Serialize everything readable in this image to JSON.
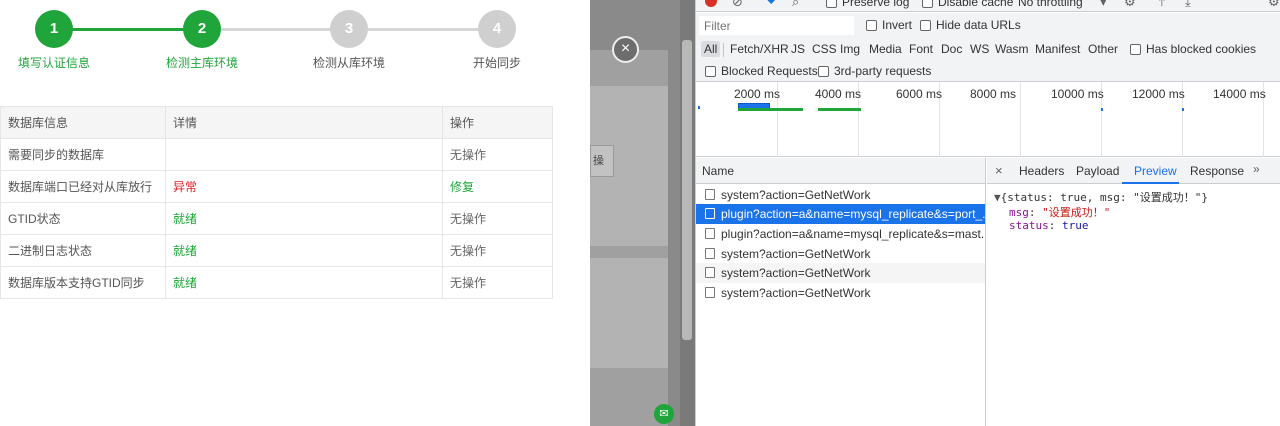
{
  "steps": [
    {
      "number": "1",
      "label": "填写认证信息",
      "state": "done"
    },
    {
      "number": "2",
      "label": "检测主库环境",
      "state": "done"
    },
    {
      "number": "3",
      "label": "检测从库环境",
      "state": "todo"
    },
    {
      "number": "4",
      "label": "开始同步",
      "state": "todo"
    }
  ],
  "table": {
    "headers": [
      "数据库信息",
      "详情",
      "操作"
    ],
    "rows": [
      {
        "info": "需要同步的数据库",
        "detail": "",
        "action": "无操作",
        "detail_status": "none",
        "action_type": "none"
      },
      {
        "info": "数据库端口已经对从库放行",
        "detail": "异常",
        "action": "修复",
        "detail_status": "error",
        "action_type": "fix"
      },
      {
        "info": "GTID状态",
        "detail": "就绪",
        "action": "无操作",
        "detail_status": "ok",
        "action_type": "none"
      },
      {
        "info": "二进制日志状态",
        "detail": "就绪",
        "action": "无操作",
        "detail_status": "ok",
        "action_type": "none"
      },
      {
        "info": "数据库版本支持GTID同步",
        "detail": "就绪",
        "action": "无操作",
        "detail_status": "ok",
        "action_type": "none"
      }
    ]
  },
  "overlay": {
    "header_fragment": "操作",
    "close_symbol": "×"
  },
  "devtools": {
    "toolbar": {
      "preserve_log": "Preserve log",
      "disable_cache": "Disable cache",
      "throttling": "No throttling"
    },
    "filter": {
      "placeholder": "Filter",
      "invert": "Invert",
      "hide_data_urls": "Hide data URLs"
    },
    "types": [
      "All",
      "Fetch/XHR",
      "JS",
      "CSS",
      "Img",
      "Media",
      "Font",
      "Doc",
      "WS",
      "Wasm",
      "Manifest",
      "Other"
    ],
    "active_type": "All",
    "has_blocked_cookies": "Has blocked cookies",
    "blocked_requests": "Blocked Requests",
    "third_party_requests": "3rd-party requests",
    "timeline_ticks": [
      "2000 ms",
      "4000 ms",
      "6000 ms",
      "8000 ms",
      "10000 ms",
      "12000 ms",
      "14000 ms"
    ],
    "name_header": "Name",
    "requests": [
      {
        "name": "system?action=GetNetWork",
        "selected": false
      },
      {
        "name": "plugin?action=a&name=mysql_replicate&s=port_...",
        "selected": true
      },
      {
        "name": "plugin?action=a&name=mysql_replicate&s=mast...",
        "selected": false
      },
      {
        "name": "system?action=GetNetWork",
        "selected": false
      },
      {
        "name": "system?action=GetNetWork",
        "selected": false
      },
      {
        "name": "system?action=GetNetWork",
        "selected": false
      }
    ],
    "detail_tabs": [
      "Headers",
      "Payload",
      "Preview",
      "Response"
    ],
    "active_detail_tab": "Preview",
    "preview": {
      "summary": "{status: true, msg: \"设置成功！\"}",
      "msg_key": "msg",
      "msg_value": "\"设置成功！\"",
      "status_key": "status",
      "status_value": "true"
    }
  }
}
